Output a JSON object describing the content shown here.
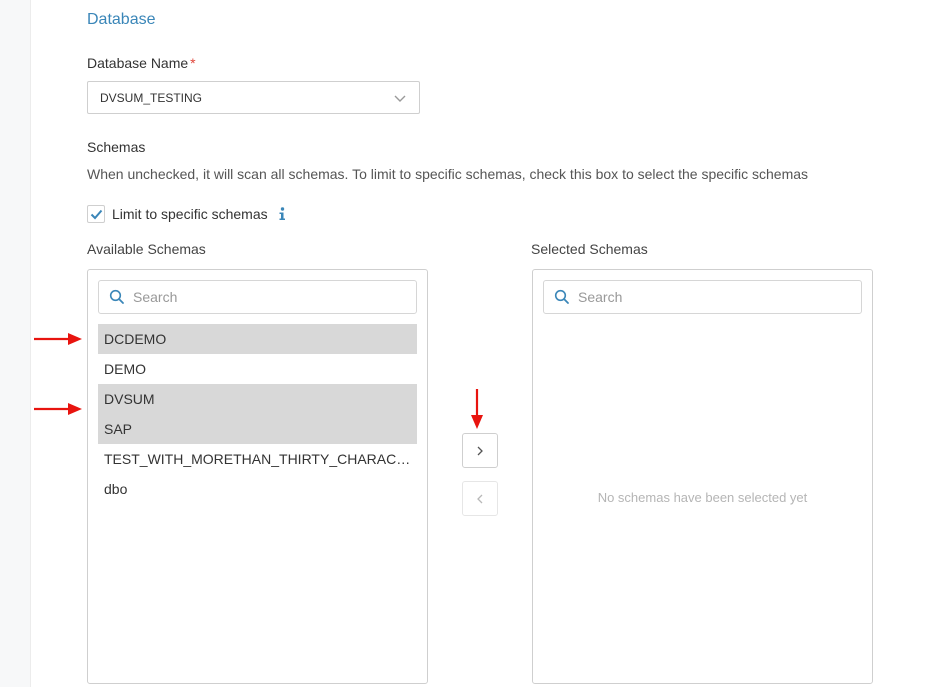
{
  "section": {
    "title": "Database"
  },
  "database": {
    "label": "Database Name",
    "required_mark": "*",
    "value": "DVSUM_TESTING",
    "dropdown_icon": "chevron-down-icon"
  },
  "schemas": {
    "title": "Schemas",
    "description": "When unchecked, it will scan all schemas. To limit to specific schemas, check this box to select the specific schemas",
    "limit_checkbox": {
      "label": "Limit to specific schemas",
      "checked": true,
      "info_icon": "info-icon"
    }
  },
  "available": {
    "label": "Available Schemas",
    "search_placeholder": "Search",
    "items": [
      {
        "name": "DCDEMO",
        "selected": true
      },
      {
        "name": "DEMO",
        "selected": false
      },
      {
        "name": "DVSUM",
        "selected": true
      },
      {
        "name": "SAP",
        "selected": true
      },
      {
        "name": "TEST_WITH_MORETHAN_THIRTY_CHARACTER...",
        "selected": false
      },
      {
        "name": "dbo",
        "selected": false
      }
    ]
  },
  "selected": {
    "label": "Selected Schemas",
    "search_placeholder": "Search",
    "empty_message": "No schemas have been selected yet"
  },
  "transfer": {
    "move_right_label": ">",
    "move_left_label": "<"
  },
  "colors": {
    "accent": "#3a86b8",
    "required": "#e0453a",
    "selected_row": "#d8d8d8",
    "annotation_arrow": "#e8140f"
  }
}
